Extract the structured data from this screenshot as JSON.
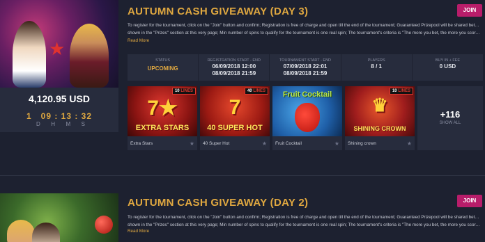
{
  "tournaments": [
    {
      "title": "AUTUMN CASH GIVEAWAY (DAY 3)",
      "join_label": "JOIN",
      "description_line1": "To register for the tournament, click on the \"Join\" button and confirm; Registration is free of charge and open till the end of the tournament; Guaranteed Prizepool will be shared between winners as",
      "description_line2": "shown in the \"Prizes\" section at this very page; Min number of spins to qualify for the tournament is one real spin; The tournament's criteria is \"The more you bet, the more you score\"; Points rece ...",
      "read_more": "Read More",
      "prize": "4,120.95 USD",
      "timer": "1   09 : 13 : 32",
      "timer_labels": [
        "D",
        "H",
        "M",
        "S"
      ],
      "stats": [
        {
          "label": "STATUS",
          "value": "UPCOMING",
          "highlight": true
        },
        {
          "label": "REGISTRATION START - END",
          "value": "06/09/2018 12:00",
          "value2": "08/09/2018 21:59"
        },
        {
          "label": "TOURNAMENT START - END",
          "value": "07/09/2018 22:01",
          "value2": "08/09/2018 21:59"
        },
        {
          "label": "PLAYERS",
          "value": "8 / 1"
        },
        {
          "label": "BUY IN + FEE",
          "value": "0 USD"
        }
      ],
      "games": [
        {
          "name": "Extra Stars",
          "thumb_title": "EXTRA STARS",
          "lines_num": "10",
          "lines_word": "LINES"
        },
        {
          "name": "40 Super Hot",
          "thumb_title": "40 SUPER HOT",
          "lines_num": "40",
          "lines_word": "LINES"
        },
        {
          "name": "Fruit Cocktail",
          "thumb_title": "Fruit Cocktail"
        },
        {
          "name": "Shining crown",
          "thumb_title": "SHINING CROWN",
          "lines_num": "10",
          "lines_word": "LINES"
        }
      ],
      "show_all_count": "+116",
      "show_all_label": "SHOW ALL"
    },
    {
      "title": "AUTUMN CASH GIVEAWAY (DAY 2)",
      "join_label": "JOIN",
      "description_line1": "To register for the tournament, click on the \"Join\" button and confirm; Registration is free of charge and open till the end of the tournament; Guaranteed Prizepool will be shared between winners as",
      "description_line2": "shown in the \"Prizes\" section at this very page; Min number of spins to qualify for the tournament is one real spin; The tournament's criteria is \"The more you bet, the more you score\"; Points rece ...",
      "read_more": "Read More"
    }
  ],
  "colors": {
    "accent": "#e0a840",
    "join": "#b81d6a",
    "background": "#1d2130",
    "panel": "#272c3d"
  }
}
